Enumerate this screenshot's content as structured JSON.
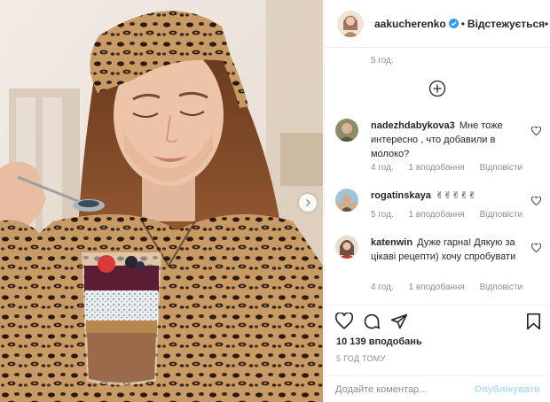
{
  "post": {
    "username": "aakucherenko",
    "follow_status": "Відстежується",
    "top_comment_time": "5 год.",
    "likes": "10 139 вподобань",
    "posted_ago": "5 ГОД ТОМУ",
    "comment_placeholder": "Додайте коментар...",
    "publish_label": "Опублікувати"
  },
  "comments": [
    {
      "username": "nadezhdabykova3",
      "text": "Мне тоже интересно , что добавили в молоко?",
      "time": "4 год.",
      "likes": "1 вподобання",
      "reply": "Відповісти"
    },
    {
      "username": "rogatinskaya",
      "text": "✌✌✌✌✌",
      "time": "5 год.",
      "likes": "1 вподобання",
      "reply": "Відповісти"
    },
    {
      "username": "katenwin",
      "text": "Дуже гарна! Дякую за цікаві рецепти) хочу спробувати",
      "time": "4 год.",
      "likes": "1 вподобання",
      "reply": "Відповісти"
    }
  ],
  "colors": {
    "text": "#262626",
    "muted": "#8e8e8e",
    "verified": "#3897f0",
    "publish_disabled": "#b3dbff",
    "divider": "#efefef"
  },
  "icons": {
    "verified": "verified-badge-icon",
    "more": "more-options-icon",
    "load_more": "plus-circle-icon",
    "like": "heart-icon",
    "comment": "comment-bubble-icon",
    "share": "paper-plane-icon",
    "save": "bookmark-icon",
    "next": "chevron-right-icon"
  }
}
